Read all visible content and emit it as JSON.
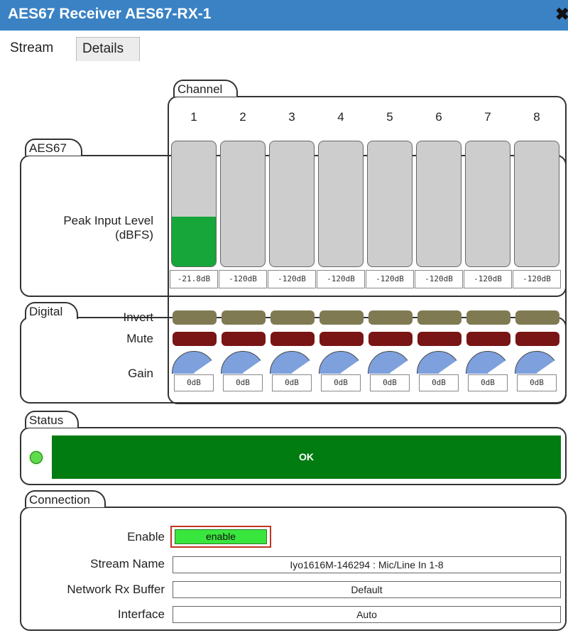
{
  "window": {
    "title": "AES67 Receiver AES67-RX-1",
    "close_glyph": "✖"
  },
  "tabs": [
    {
      "label": "Stream",
      "active": true
    },
    {
      "label": "Details",
      "active": false
    }
  ],
  "groups": {
    "channel": "Channel",
    "aes67": "AES67",
    "digital": "Digital",
    "status": "Status",
    "connection": "Connection"
  },
  "labels": {
    "peak_input_level_line1": "Peak Input Level",
    "peak_input_level_line2": "(dBFS)",
    "invert": "Invert",
    "mute": "Mute",
    "gain": "Gain"
  },
  "channels": [
    {
      "number": "1",
      "peak_db": "-21.8dB",
      "peak_fraction": 0.4,
      "gain": "0dB"
    },
    {
      "number": "2",
      "peak_db": "-120dB",
      "peak_fraction": 0,
      "gain": "0dB"
    },
    {
      "number": "3",
      "peak_db": "-120dB",
      "peak_fraction": 0,
      "gain": "0dB"
    },
    {
      "number": "4",
      "peak_db": "-120dB",
      "peak_fraction": 0,
      "gain": "0dB"
    },
    {
      "number": "5",
      "peak_db": "-120dB",
      "peak_fraction": 0,
      "gain": "0dB"
    },
    {
      "number": "6",
      "peak_db": "-120dB",
      "peak_fraction": 0,
      "gain": "0dB"
    },
    {
      "number": "7",
      "peak_db": "-120dB",
      "peak_fraction": 0,
      "gain": "0dB"
    },
    {
      "number": "8",
      "peak_db": "-120dB",
      "peak_fraction": 0,
      "gain": "0dB"
    }
  ],
  "status": {
    "text": "OK",
    "color": "#007c10",
    "led_color": "#5edc4a"
  },
  "connection": {
    "enable_label": "Enable",
    "enable_value": "enable",
    "stream_name_label": "Stream Name",
    "stream_name_value": "Iyo1616M-146294 : Mic/Line In 1-8",
    "network_rx_buffer_label": "Network Rx Buffer",
    "network_rx_buffer_value": "Default",
    "interface_label": "Interface",
    "interface_value": "Auto"
  },
  "colors": {
    "titlebar": "#3a82c4",
    "meter_fill": "#16a63a",
    "invert_button": "#7f7a52",
    "mute_button": "#7a1515",
    "gain_dial": "#7ea1dd",
    "enable_button": "#39e63d",
    "enable_highlight": "#c0351f"
  },
  "icons": {
    "status_led": "led-indicator-icon",
    "close": "close-icon"
  }
}
